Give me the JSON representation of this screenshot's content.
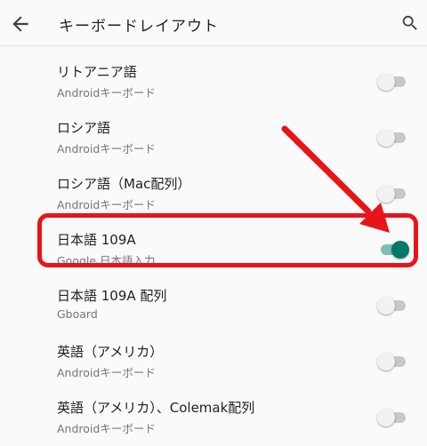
{
  "header": {
    "title": "キーボードレイアウト",
    "back_icon": "arrow-left-icon",
    "search_icon": "search-icon"
  },
  "colors": {
    "accent": "#00796b",
    "annotation": "#e8141a"
  },
  "layouts": [
    {
      "name": "リトアニア語",
      "subtitle": "Androidキーボード",
      "enabled": false
    },
    {
      "name": "ロシア語",
      "subtitle": "Androidキーボード",
      "enabled": false
    },
    {
      "name": "ロシア語（Mac配列）",
      "subtitle": "Androidキーボード",
      "enabled": false
    },
    {
      "name": "日本語 109A",
      "subtitle": "Google 日本語入力",
      "enabled": true
    },
    {
      "name": "日本語 109A 配列",
      "subtitle": "Gboard",
      "enabled": false
    },
    {
      "name": "英語（アメリカ）",
      "subtitle": "Androidキーボード",
      "enabled": false
    },
    {
      "name": "英語（アメリカ）、Colemak配列",
      "subtitle": "Androidキーボード",
      "enabled": false
    }
  ]
}
